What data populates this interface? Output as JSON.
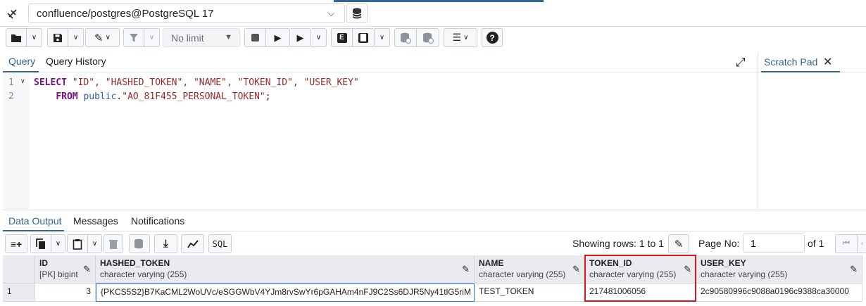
{
  "connection": {
    "label": "confluence/postgres@PostgreSQL 17"
  },
  "toolbar": {
    "limit_value": "No limit"
  },
  "query_tabs": [
    "Query",
    "Query History"
  ],
  "editor": {
    "line_numbers": [
      "1",
      "2"
    ],
    "line1": {
      "kw": "SELECT",
      "rest": " \"ID\", \"HASHED_TOKEN\", \"NAME\", \"TOKEN_ID\", \"USER_KEY\""
    },
    "line2": {
      "indent": "    ",
      "kw": "FROM",
      "schema": " public",
      "dot": ".",
      "table": "\"AO_81F455_PERSONAL_TOKEN\"",
      "semi": ";"
    }
  },
  "scratch_pad": {
    "title": "Scratch Pad"
  },
  "output_tabs": [
    "Data Output",
    "Messages",
    "Notifications"
  ],
  "output_toolbar": {
    "sql_label": "SQL",
    "rows_info": "Showing rows: 1 to 1",
    "page_label": "Page No:",
    "page_value": "1",
    "of_label": "of 1"
  },
  "grid": {
    "columns": [
      {
        "name": "ID",
        "type": "[PK] bigint"
      },
      {
        "name": "HASHED_TOKEN",
        "type": "character varying (255)"
      },
      {
        "name": "NAME",
        "type": "character varying (255)"
      },
      {
        "name": "TOKEN_ID",
        "type": "character varying (255)"
      },
      {
        "name": "USER_KEY",
        "type": "character varying (255)"
      }
    ],
    "rows": [
      {
        "row_number": "1",
        "cells": [
          "3",
          "{PKCS5S2}B7KaCML2WoUVc/eSGGWbV4YJm8rvSwYr6pGAHAm4nFJ9C2Ss6DJR5Ny41tlG5riM",
          "TEST_TOKEN",
          "217481006056",
          "2c90580996c9088a0196c9388ca30000"
        ]
      }
    ]
  },
  "icons": {
    "pencil": "✎",
    "close": "✕",
    "expand": "⤢"
  },
  "colors": {
    "accent": "#326690",
    "highlight_box": "#e0141b"
  }
}
